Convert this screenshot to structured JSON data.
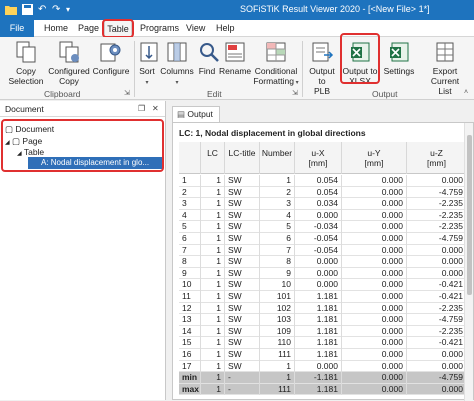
{
  "titlebar": {
    "title": "SOFiSTiK Result Viewer 2020 - [<New File> 1*]",
    "qa_icons": [
      "folder-icon",
      "save-icon",
      "undo-icon",
      "redo-icon",
      "customize-icon"
    ]
  },
  "menu": {
    "file": "File",
    "tabs": [
      "Home",
      "Page",
      "Table",
      "Programs",
      "View",
      "Help"
    ],
    "active_tab": "Table"
  },
  "ribbon": {
    "groups": {
      "clipboard": "Clipboard",
      "edit": "Edit",
      "output": "Output"
    },
    "buttons": {
      "copy_selection": "Copy\nSelection",
      "configured_copy": "Configured\nCopy",
      "configure": "Configure",
      "sort": "Sort",
      "columns": "Columns",
      "find": "Find",
      "rename": "Rename",
      "conditional_formatting": "Conditional\nFormatting",
      "output_to_plb": "Output to\nPLB",
      "output_to_xlsx": "Output to\nXLSX",
      "settings": "Settings",
      "export_current_list": "Export Current\nList"
    }
  },
  "document_panel": {
    "title": "Document",
    "tree": {
      "document": "Document",
      "page": "Page",
      "table": "Table",
      "selected_item": "A: Nodal displacement in glo..."
    }
  },
  "output_panel": {
    "tab": "Output",
    "caption": "LC: 1,  Nodal displacement in global directions",
    "columns": [
      {
        "line1": "",
        "line2": ""
      },
      {
        "line1": "LC",
        "line2": ""
      },
      {
        "line1": "LC-title",
        "line2": ""
      },
      {
        "line1": "Number",
        "line2": ""
      },
      {
        "line1": "u-X",
        "line2": "[mm]"
      },
      {
        "line1": "u-Y",
        "line2": "[mm]"
      },
      {
        "line1": "u-Z",
        "line2": "[mm]"
      }
    ],
    "rows": [
      [
        "1",
        "1",
        "SW",
        "1",
        "0.054",
        "0.000",
        "0.000"
      ],
      [
        "2",
        "1",
        "SW",
        "2",
        "0.054",
        "0.000",
        "-4.759"
      ],
      [
        "3",
        "1",
        "SW",
        "3",
        "0.034",
        "0.000",
        "-2.235"
      ],
      [
        "4",
        "1",
        "SW",
        "4",
        "0.000",
        "0.000",
        "-2.235"
      ],
      [
        "5",
        "1",
        "SW",
        "5",
        "-0.034",
        "0.000",
        "-2.235"
      ],
      [
        "6",
        "1",
        "SW",
        "6",
        "-0.054",
        "0.000",
        "-4.759"
      ],
      [
        "7",
        "1",
        "SW",
        "7",
        "-0.054",
        "0.000",
        "0.000"
      ],
      [
        "8",
        "1",
        "SW",
        "8",
        "0.000",
        "0.000",
        "0.000"
      ],
      [
        "9",
        "1",
        "SW",
        "9",
        "0.000",
        "0.000",
        "0.000"
      ],
      [
        "10",
        "1",
        "SW",
        "10",
        "0.000",
        "0.000",
        "-0.421"
      ],
      [
        "11",
        "1",
        "SW",
        "101",
        "1.181",
        "0.000",
        "-0.421"
      ],
      [
        "12",
        "1",
        "SW",
        "102",
        "1.181",
        "0.000",
        "-2.235"
      ],
      [
        "13",
        "1",
        "SW",
        "103",
        "1.181",
        "0.000",
        "-4.759"
      ],
      [
        "14",
        "1",
        "SW",
        "109",
        "1.181",
        "0.000",
        "-2.235"
      ],
      [
        "15",
        "1",
        "SW",
        "110",
        "1.181",
        "0.000",
        "-0.421"
      ],
      [
        "16",
        "1",
        "SW",
        "111",
        "1.181",
        "0.000",
        "0.000"
      ],
      [
        "17",
        "1",
        "SW",
        "1",
        "0.000",
        "0.000",
        "0.000"
      ]
    ],
    "summary": [
      [
        "min",
        "1",
        "-",
        "1",
        "-1.181",
        "0.000",
        "-4.759"
      ],
      [
        "max",
        "1",
        "-",
        "111",
        "1.181",
        "0.000",
        "0.000"
      ]
    ]
  }
}
